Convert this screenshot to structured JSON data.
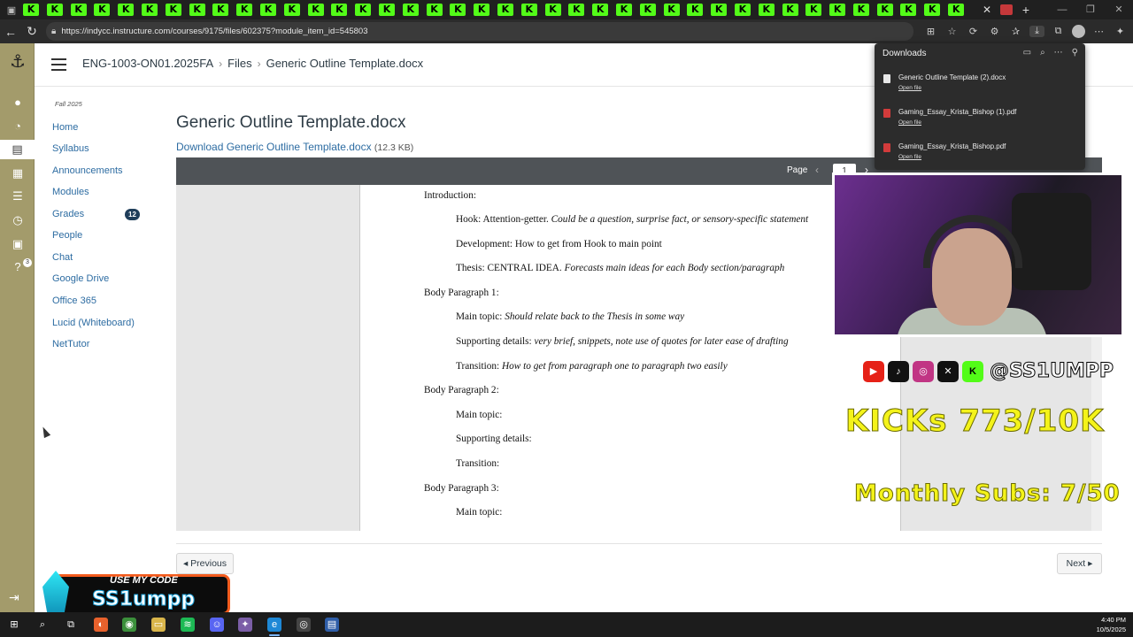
{
  "browser": {
    "url": "https://indycc.instructure.com/courses/9175/files/602375?module_item_id=545803",
    "kick_tab_glyph": "K",
    "kick_tab_count": 40,
    "colors": {
      "kick": "#53fc18",
      "tabstrip": "#202020",
      "addressbar": "#2b2b2b"
    }
  },
  "breadcrumb": {
    "course": "ENG-1003-ON01.2025FA",
    "files": "Files",
    "current": "Generic Outline Template.docx"
  },
  "course_nav": {
    "term": "Fall 2025",
    "items": [
      {
        "label": "Home"
      },
      {
        "label": "Syllabus"
      },
      {
        "label": "Announcements"
      },
      {
        "label": "Modules"
      },
      {
        "label": "Grades",
        "badge": "12"
      },
      {
        "label": "People"
      },
      {
        "label": "Chat"
      },
      {
        "label": "Google Drive"
      },
      {
        "label": "Office 365"
      },
      {
        "label": "Lucid (Whiteboard)"
      },
      {
        "label": "NetTutor"
      }
    ]
  },
  "global_nav": {
    "icons": [
      "account-icon",
      "dashboard-icon",
      "courses-icon",
      "calendar-icon",
      "inbox-icon",
      "history-icon",
      "studio-icon",
      "help-icon"
    ],
    "help_badge": "3",
    "color": "#a39b6b"
  },
  "file": {
    "title": "Generic Outline Template.docx",
    "download_label": "Download Generic Outline Template.docx",
    "size": "(12.3 KB)"
  },
  "viewer": {
    "page_label": "Page",
    "page_number": "1"
  },
  "document": {
    "lines": [
      {
        "plain": "Introduction:",
        "italic": ""
      },
      {
        "plain": "Hook: Attention-getter. ",
        "italic": "Could be a question, surprise fact, or sensory-specific statement"
      },
      {
        "plain": "Development: How to get from Hook to main point",
        "italic": ""
      },
      {
        "plain": "Thesis: CENTRAL IDEA. ",
        "italic": "Forecasts main ideas for each Body section/paragraph"
      },
      {
        "plain": "Body Paragraph 1:",
        "italic": ""
      },
      {
        "plain": "Main topic: ",
        "italic": "Should relate back to the Thesis in some way"
      },
      {
        "plain": "Supporting details: ",
        "italic": "very brief, snippets, note use of quotes for later ease of drafting"
      },
      {
        "plain": "Transition: ",
        "italic": "How to get from paragraph one to paragraph two easily"
      },
      {
        "plain": "Body Paragraph 2:",
        "italic": ""
      },
      {
        "plain": "Main topic:",
        "italic": ""
      },
      {
        "plain": "Supporting details:",
        "italic": ""
      },
      {
        "plain": "Transition:",
        "italic": ""
      },
      {
        "plain": "Body Paragraph 3:",
        "italic": ""
      },
      {
        "plain": "Main topic:",
        "italic": ""
      }
    ]
  },
  "pagination": {
    "previous": "◂ Previous",
    "next": "Next ▸"
  },
  "downloads": {
    "title": "Downloads",
    "items": [
      {
        "name": "Generic Outline Template (2).docx",
        "action": "Open file",
        "type": "docx"
      },
      {
        "name": "Gaming_Essay_Krista_Bishop (1).pdf",
        "action": "Open file",
        "type": "pdf"
      },
      {
        "name": "Gaming_Essay_Krista_Bishop.pdf",
        "action": "Open file",
        "type": "pdf"
      }
    ]
  },
  "overlay": {
    "handle": "@SS1UMPP",
    "kicks": "KICKs 773/10K",
    "subs": "Monthly Subs: 7/50",
    "promo_heading": "USE MY CODE",
    "promo_code": "SS1umpp",
    "social_icons": [
      "youtube-icon",
      "tiktok-icon",
      "instagram-icon",
      "x-icon",
      "kick-icon"
    ]
  },
  "taskbar": {
    "time": "4:40 PM",
    "date": "10/5/2025"
  }
}
